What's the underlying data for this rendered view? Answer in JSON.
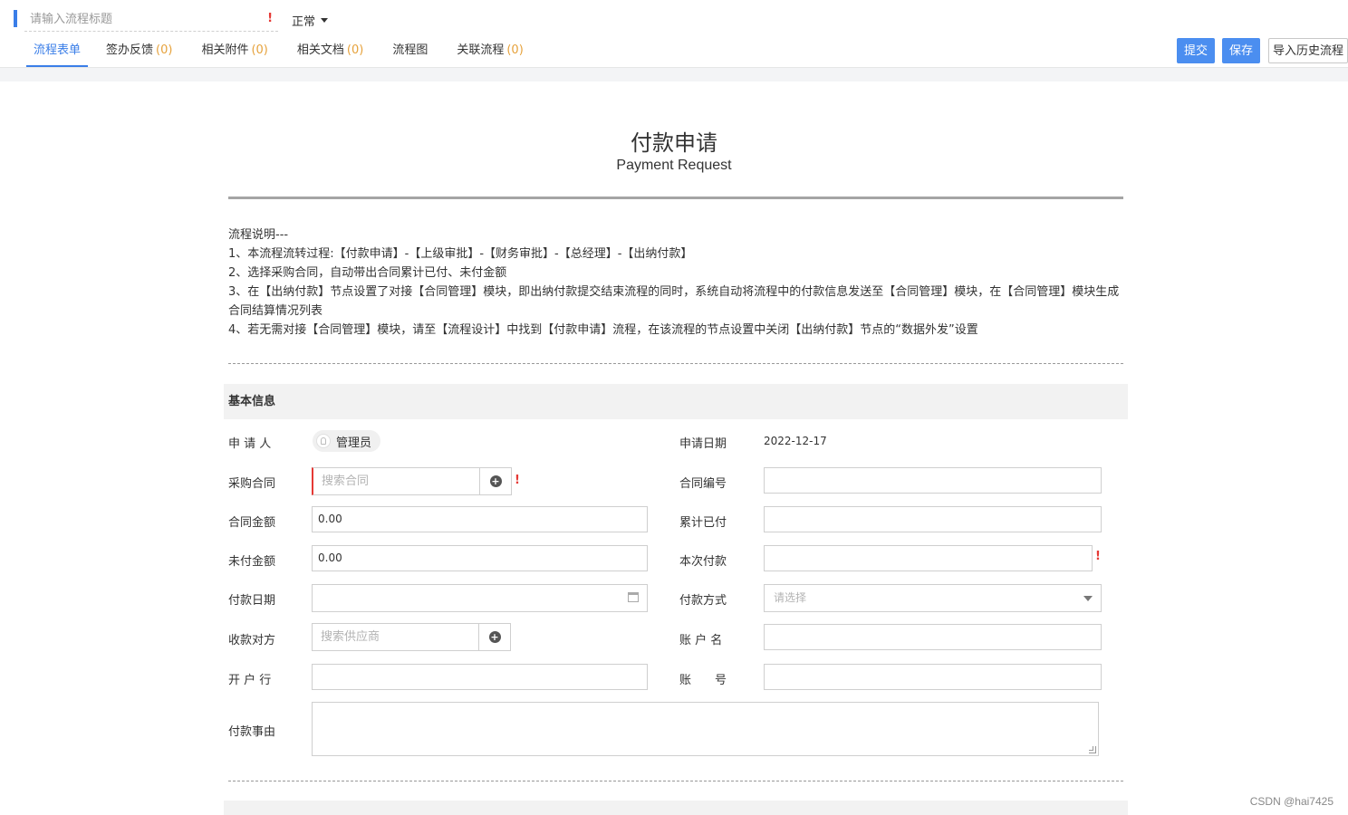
{
  "header": {
    "title_placeholder": "请输入流程标题",
    "required_mark": "!",
    "status": "正常",
    "tabs": [
      {
        "label": "流程表单",
        "count": ""
      },
      {
        "label": "签办反馈",
        "count": "(0)"
      },
      {
        "label": "相关附件",
        "count": "(0)"
      },
      {
        "label": "相关文档",
        "count": "(0)"
      },
      {
        "label": "流程图",
        "count": ""
      },
      {
        "label": "关联流程",
        "count": "(0)"
      }
    ],
    "buttons": {
      "submit": "提交",
      "save": "保存",
      "import": "导入历史流程"
    }
  },
  "form": {
    "title": "付款申请",
    "subtitle": "Payment Request",
    "description": [
      "流程说明---",
      "1、本流程流转过程:【付款申请】-【上级审批】-【财务审批】-【总经理】-【出纳付款】",
      "2、选择采购合同，自动带出合同累计已付、未付金额",
      "3、在【出纳付款】节点设置了对接【合同管理】模块，即出纳付款提交结束流程的同时，系统自动将流程中的付款信息发送至【合同管理】模块，在【合同管理】模块生成合同结算情况列表",
      "4、若无需对接【合同管理】模块，请至【流程设计】中找到【付款申请】流程，在该流程的节点设置中关闭【出纳付款】节点的“数据外发”设置"
    ],
    "section_basic": "基本信息",
    "fields": {
      "applicant_label": "申 请 人",
      "applicant_value": "管理员",
      "apply_date_label": "申请日期",
      "apply_date_value": "2022-12-17",
      "contract_label": "采购合同",
      "contract_placeholder": "搜索合同",
      "contract_no_label": "合同编号",
      "contract_amount_label": "合同金额",
      "contract_amount_value": "0.00",
      "paid_total_label": "累计已付",
      "unpaid_label": "未付金额",
      "unpaid_value": "0.00",
      "this_payment_label": "本次付款",
      "pay_date_label": "付款日期",
      "pay_method_label": "付款方式",
      "pay_method_placeholder": "请选择",
      "payee_label": "收款对方",
      "payee_placeholder": "搜索供应商",
      "account_name_label": "账 户 名",
      "bank_label": "开 户 行",
      "account_no_label": "账　　号",
      "reason_label": "付款事由"
    }
  },
  "watermark": "CSDN @hai7425"
}
